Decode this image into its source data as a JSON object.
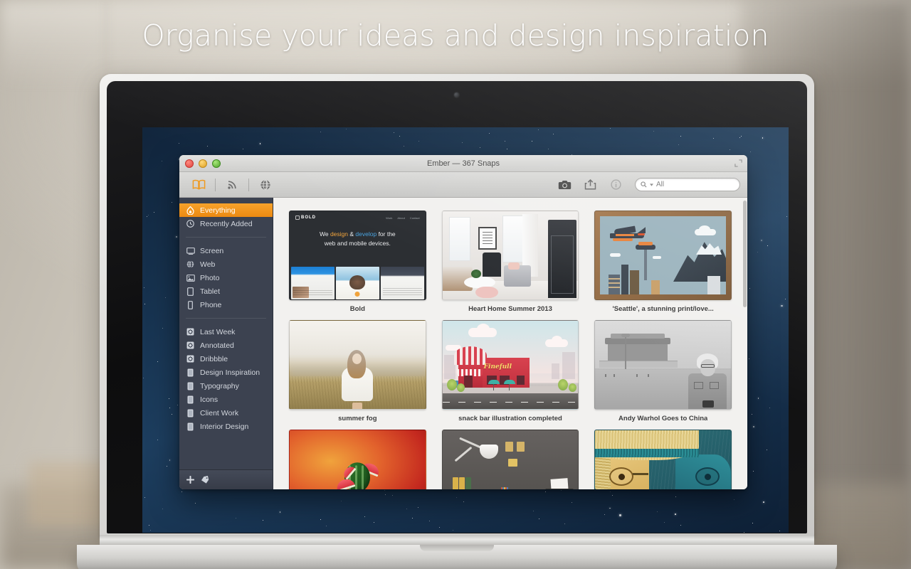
{
  "marketing": {
    "headline": "Organise your ideas and design inspiration"
  },
  "window": {
    "title": "Ember — 367 Snaps",
    "traffic_lights": [
      "close-button",
      "minimize-button",
      "zoom-button"
    ],
    "fullscreen_icon": "fullscreen-icon"
  },
  "toolbar": {
    "left_items": [
      {
        "name": "library-icon",
        "label": "Library"
      },
      {
        "name": "rss-feeds-icon",
        "label": "Feeds"
      },
      {
        "name": "web-browser-icon",
        "label": "Web"
      }
    ],
    "right_items": [
      {
        "name": "camera-icon",
        "label": "Capture"
      },
      {
        "name": "share-icon",
        "label": "Share"
      },
      {
        "name": "info-icon",
        "label": "Info"
      }
    ],
    "search": {
      "value": "",
      "placeholder": "All",
      "scope_label": "All"
    }
  },
  "sidebar": {
    "groups": [
      {
        "items": [
          {
            "label": "Everything",
            "icon": "flame-icon",
            "active": true
          },
          {
            "label": "Recently Added",
            "icon": "clock-icon",
            "active": false
          }
        ]
      },
      {
        "items": [
          {
            "label": "Screen",
            "icon": "display-icon",
            "active": false
          },
          {
            "label": "Web",
            "icon": "globe-icon",
            "active": false
          },
          {
            "label": "Photo",
            "icon": "photo-icon",
            "active": false
          },
          {
            "label": "Tablet",
            "icon": "tablet-icon",
            "active": false
          },
          {
            "label": "Phone",
            "icon": "phone-icon",
            "active": false
          }
        ]
      },
      {
        "items": [
          {
            "label": "Last Week",
            "icon": "smart-folder-icon",
            "active": false
          },
          {
            "label": "Annotated",
            "icon": "smart-folder-icon",
            "active": false
          },
          {
            "label": "Dribbble",
            "icon": "smart-folder-icon",
            "active": false
          },
          {
            "label": "Design Inspiration",
            "icon": "folder-icon",
            "active": false
          },
          {
            "label": "Typography",
            "icon": "folder-icon",
            "active": false
          },
          {
            "label": "Icons",
            "icon": "folder-icon",
            "active": false
          },
          {
            "label": "Client Work",
            "icon": "folder-icon",
            "active": false
          },
          {
            "label": "Interior Design",
            "icon": "folder-icon",
            "active": false
          }
        ]
      }
    ],
    "bottom_bar": [
      {
        "name": "add-collection-button",
        "icon": "plus-icon"
      },
      {
        "name": "tag-button",
        "icon": "tag-icon"
      }
    ]
  },
  "content": {
    "items": [
      {
        "caption": "Bold",
        "art": "bold"
      },
      {
        "caption": "Heart Home Summer 2013",
        "art": "home"
      },
      {
        "caption": "'Seattle', a stunning print/love...",
        "art": "seattle"
      },
      {
        "caption": "summer fog",
        "art": "fog"
      },
      {
        "caption": "snack bar illustration completed",
        "art": "snack"
      },
      {
        "caption": "Andy Warhol Goes to China",
        "art": "warhol"
      },
      {
        "caption": "",
        "art": "melon"
      },
      {
        "caption": "",
        "art": "desk"
      },
      {
        "caption": "",
        "art": "portrait"
      }
    ],
    "bold_thumb": {
      "logo": "BOLD",
      "nav": [
        "Work",
        "About",
        "Contact"
      ],
      "hero_line1_pre": "We ",
      "hero_line1_orange": "design",
      "hero_line1_mid": " & ",
      "hero_line1_blue": "develop",
      "hero_line1_post": " for the",
      "hero_line2": "web and mobile devices."
    },
    "snack_thumb": {
      "sign": "Finefull"
    }
  },
  "colors": {
    "accent_orange": "#f0a33c",
    "sidebar_bg": "#3c4250",
    "content_bg": "#f2f1ef",
    "selection": "#ec8a12"
  }
}
